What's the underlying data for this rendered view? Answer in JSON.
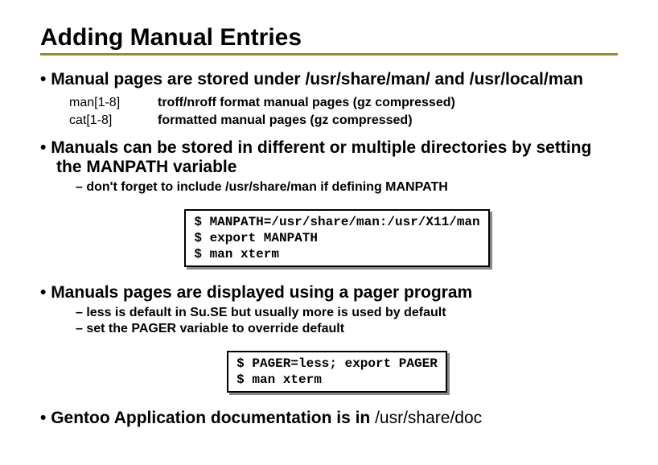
{
  "title": "Adding Manual Entries",
  "bullets": {
    "b1": "Manual pages are stored under /usr/share/man/ and /usr/local/man",
    "b2": "Manuals can be stored in different or multiple directories by setting the MANPATH variable",
    "b3": "Manuals pages are displayed using a pager program",
    "b4_pre": "Gentoo Application documentation is in ",
    "b4_path": "/usr/share/doc"
  },
  "defs": [
    {
      "term": "man[1-8]",
      "desc": "troff/nroff format manual pages (gz compressed)"
    },
    {
      "term": "cat[1-8]",
      "desc": "formatted manual pages (gz compressed)"
    }
  ],
  "sub2": {
    "s1": "don't forget to include /usr/share/man if defining MANPATH"
  },
  "sub3": {
    "s1": "less is default in Su.SE but usually more is used by default",
    "s2": "set the PAGER variable to override default"
  },
  "code1": "$ MANPATH=/usr/share/man:/usr/X11/man\n$ export MANPATH\n$ man xterm",
  "code2": "$ PAGER=less; export PAGER\n$ man xterm"
}
